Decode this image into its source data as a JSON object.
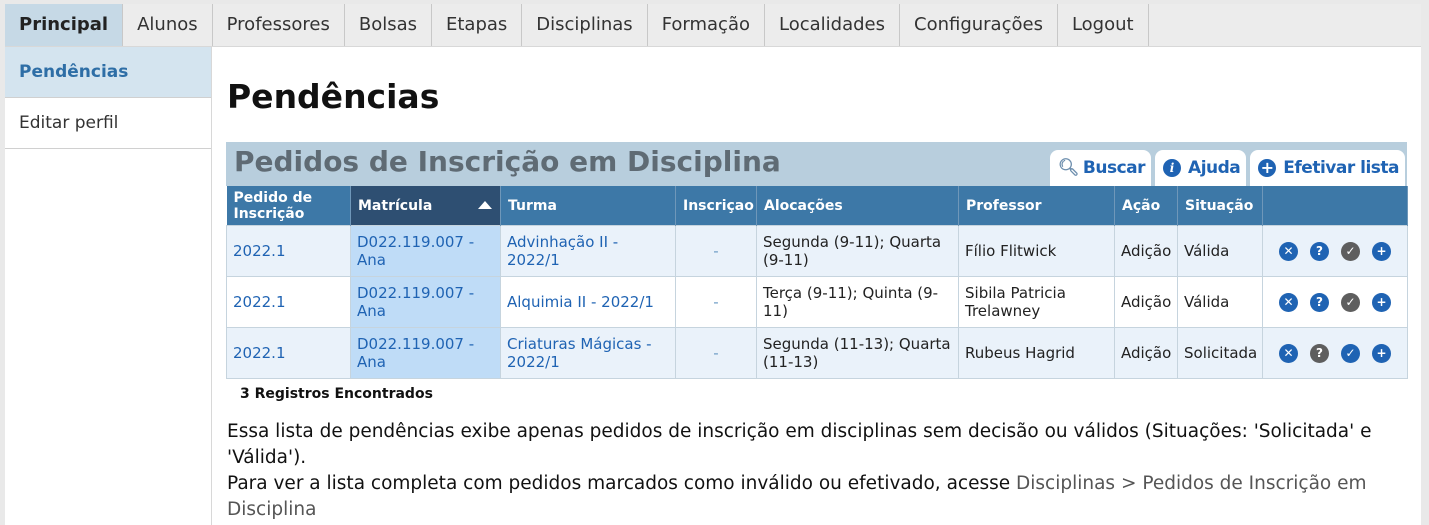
{
  "nav": {
    "tabs": [
      "Principal",
      "Alunos",
      "Professores",
      "Bolsas",
      "Etapas",
      "Disciplinas",
      "Formação",
      "Localidades",
      "Configurações",
      "Logout"
    ]
  },
  "sidebar": {
    "items": [
      "Pendências",
      "Editar perfil"
    ]
  },
  "page": {
    "title": "Pendências"
  },
  "panel": {
    "title": "Pedidos de Inscrição em Disciplina",
    "tabs": {
      "buscar": "Buscar",
      "ajuda": "Ajuda",
      "efetivar": "Efetivar lista"
    }
  },
  "table": {
    "headers": [
      "Pedido de Inscrição",
      "Matrícula",
      "Turma",
      "Inscriçao",
      "Alocações",
      "Professor",
      "Ação",
      "Situação",
      ""
    ],
    "rows": [
      [
        "2022.1",
        "D022.119.007 - Ana",
        "Advinhação II - 2022/1",
        "-",
        "Segunda (9-11); Quarta (9-11)",
        "Fílio Flitwick",
        "Adição",
        "Válida"
      ],
      [
        "2022.1",
        "D022.119.007 - Ana",
        "Alquimia II - 2022/1",
        "-",
        "Terça (9-11); Quinta (9-11)",
        "Sibila Patricia Trelawney",
        "Adição",
        "Válida"
      ],
      [
        "2022.1",
        "D022.119.007 - Ana",
        "Criaturas Mágicas - 2022/1",
        "-",
        "Segunda (11-13); Quarta (11-13)",
        "Rubeus Hagrid",
        "Adição",
        "Solicitada"
      ]
    ]
  },
  "count": "3 Registros Encontrados",
  "note": {
    "line1": "Essa lista de pendências exibe apenas pedidos de inscrição em disciplinas sem decisão ou válidos (Situações: 'Solicitada' e 'Válida').",
    "line2": "Para ver a lista completa com pedidos marcados como inválido ou efetivado, acesse ",
    "link": "Disciplinas > Pedidos de Inscrição em Disciplina"
  },
  "colors": {
    "header": "#3d78a7",
    "accent": "#1f63b3",
    "panel": "#b8cedd"
  },
  "icons": [
    "reject-icon",
    "question-icon",
    "check-icon",
    "add-icon"
  ]
}
